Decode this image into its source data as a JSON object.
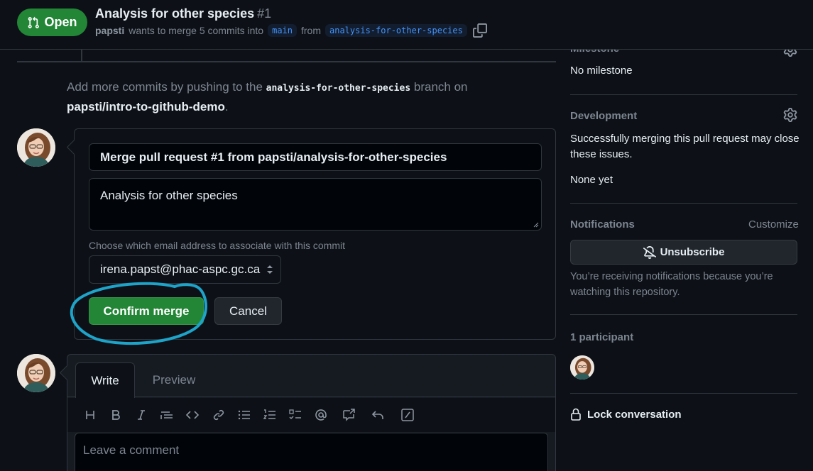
{
  "header": {
    "state_label": "Open",
    "title": "Analysis for other species",
    "number": "#1",
    "author": "papsti",
    "merge_text": "wants to merge 5 commits into",
    "base_branch": "main",
    "from_text": "from",
    "head_branch": "analysis-for-other-species"
  },
  "push_hint": {
    "prefix": "Add more commits by pushing to the",
    "branch": "analysis-for-other-species",
    "middle": "branch on",
    "repo": "papsti/intro-to-github-demo",
    "suffix": "."
  },
  "merge_form": {
    "commit_title": "Merge pull request #1 from papsti/analysis-for-other-species",
    "commit_body": "Analysis for other species",
    "email_label": "Choose which email address to associate with this commit",
    "email_value": "irena.papst@phac-aspc.gc.ca",
    "confirm_label": "Confirm merge",
    "cancel_label": "Cancel"
  },
  "comment": {
    "tab_write": "Write",
    "tab_preview": "Preview",
    "placeholder": "Leave a comment",
    "toolbar_icons": [
      "heading-icon",
      "bold-icon",
      "italic-icon",
      "quote-icon",
      "code-icon",
      "link-icon",
      "unordered-list-icon",
      "ordered-list-icon",
      "task-list-icon",
      "mention-icon",
      "cross-reference-icon",
      "reply-icon",
      "slash-command-icon"
    ]
  },
  "sidebar": {
    "milestone_header": "Milestone",
    "milestone_value": "No milestone",
    "development_header": "Development",
    "development_text": "Successfully merging this pull request may close these issues.",
    "development_value": "None yet",
    "notifications_header": "Notifications",
    "customize_label": "Customize",
    "unsubscribe_label": "Unsubscribe",
    "notifications_note": "You’re receiving notifications because you’re watching this repository.",
    "participants_header": "1 participant",
    "lock_label": "Lock conversation"
  },
  "colors": {
    "background": "#0d1117",
    "open_green": "#238636",
    "link_blue": "#4493f8",
    "muted": "#7d8590",
    "border": "#30363d",
    "annotation_ring": "#1ea3c9"
  }
}
